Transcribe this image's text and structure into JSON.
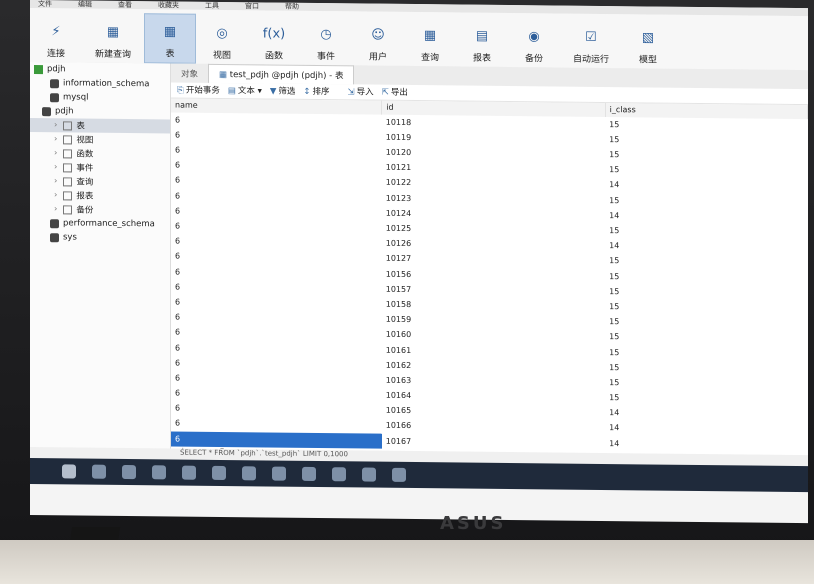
{
  "menubar": [
    "文件",
    "编辑",
    "查看",
    "收藏夹",
    "工具",
    "窗口",
    "帮助"
  ],
  "toolbar": [
    {
      "label": "连接",
      "icon": "connect-icon",
      "glyph": "⚡"
    },
    {
      "label": "新建查询",
      "icon": "new-query-icon",
      "glyph": "▦"
    },
    {
      "label": "表",
      "icon": "table-icon",
      "glyph": "▦",
      "active": true
    },
    {
      "label": "视图",
      "icon": "view-icon",
      "glyph": "◎"
    },
    {
      "label": "函数",
      "icon": "function-icon",
      "glyph": "f(x)"
    },
    {
      "label": "事件",
      "icon": "event-icon",
      "glyph": "◷"
    },
    {
      "label": "用户",
      "icon": "user-icon",
      "glyph": "☺"
    },
    {
      "label": "查询",
      "icon": "query-icon",
      "glyph": "▦"
    },
    {
      "label": "报表",
      "icon": "report-icon",
      "glyph": "▤"
    },
    {
      "label": "备份",
      "icon": "backup-icon",
      "glyph": "◉"
    },
    {
      "label": "自动运行",
      "icon": "automation-icon",
      "glyph": "☑"
    },
    {
      "label": "模型",
      "icon": "model-icon",
      "glyph": "▧"
    }
  ],
  "sidebar": {
    "connection": "pdjh",
    "databases_top": [
      "information_schema",
      "mysql"
    ],
    "open_db": "pdjh",
    "children": [
      "表",
      "视图",
      "函数",
      "事件",
      "查询",
      "报表",
      "备份"
    ],
    "databases_bottom": [
      "performance_schema",
      "sys"
    ]
  },
  "tabs": {
    "objects": "对象",
    "current": "test_pdjh @pdjh (pdjh) - 表"
  },
  "actions": {
    "begin": "开始事务",
    "text": "文本",
    "filter": "筛选",
    "sort": "排序",
    "import": "导入",
    "export": "导出"
  },
  "columns": [
    "name",
    "id",
    "i_class"
  ],
  "rows": [
    [
      "6",
      "10118",
      "15"
    ],
    [
      "6",
      "10119",
      "15"
    ],
    [
      "6",
      "10120",
      "15"
    ],
    [
      "6",
      "10121",
      "15"
    ],
    [
      "6",
      "10122",
      "14"
    ],
    [
      "6",
      "10123",
      "15"
    ],
    [
      "6",
      "10124",
      "14"
    ],
    [
      "6",
      "10125",
      "15"
    ],
    [
      "6",
      "10126",
      "14"
    ],
    [
      "6",
      "10127",
      "15"
    ],
    [
      "6",
      "10156",
      "15"
    ],
    [
      "6",
      "10157",
      "15"
    ],
    [
      "6",
      "10158",
      "15"
    ],
    [
      "6",
      "10159",
      "15"
    ],
    [
      "6",
      "10160",
      "15"
    ],
    [
      "6",
      "10161",
      "15"
    ],
    [
      "6",
      "10162",
      "15"
    ],
    [
      "6",
      "10163",
      "15"
    ],
    [
      "6",
      "10164",
      "15"
    ],
    [
      "6",
      "10165",
      "14"
    ],
    [
      "6",
      "10166",
      "14"
    ],
    [
      "6",
      "10167",
      "14"
    ]
  ],
  "status_sql": "SELECT * FROM `pdjh`.`test_pdjh` LIMIT 0,1000",
  "grid_foot": {
    "add": "+",
    "remove": "−",
    "refresh": "○"
  },
  "logo": "ASUS"
}
